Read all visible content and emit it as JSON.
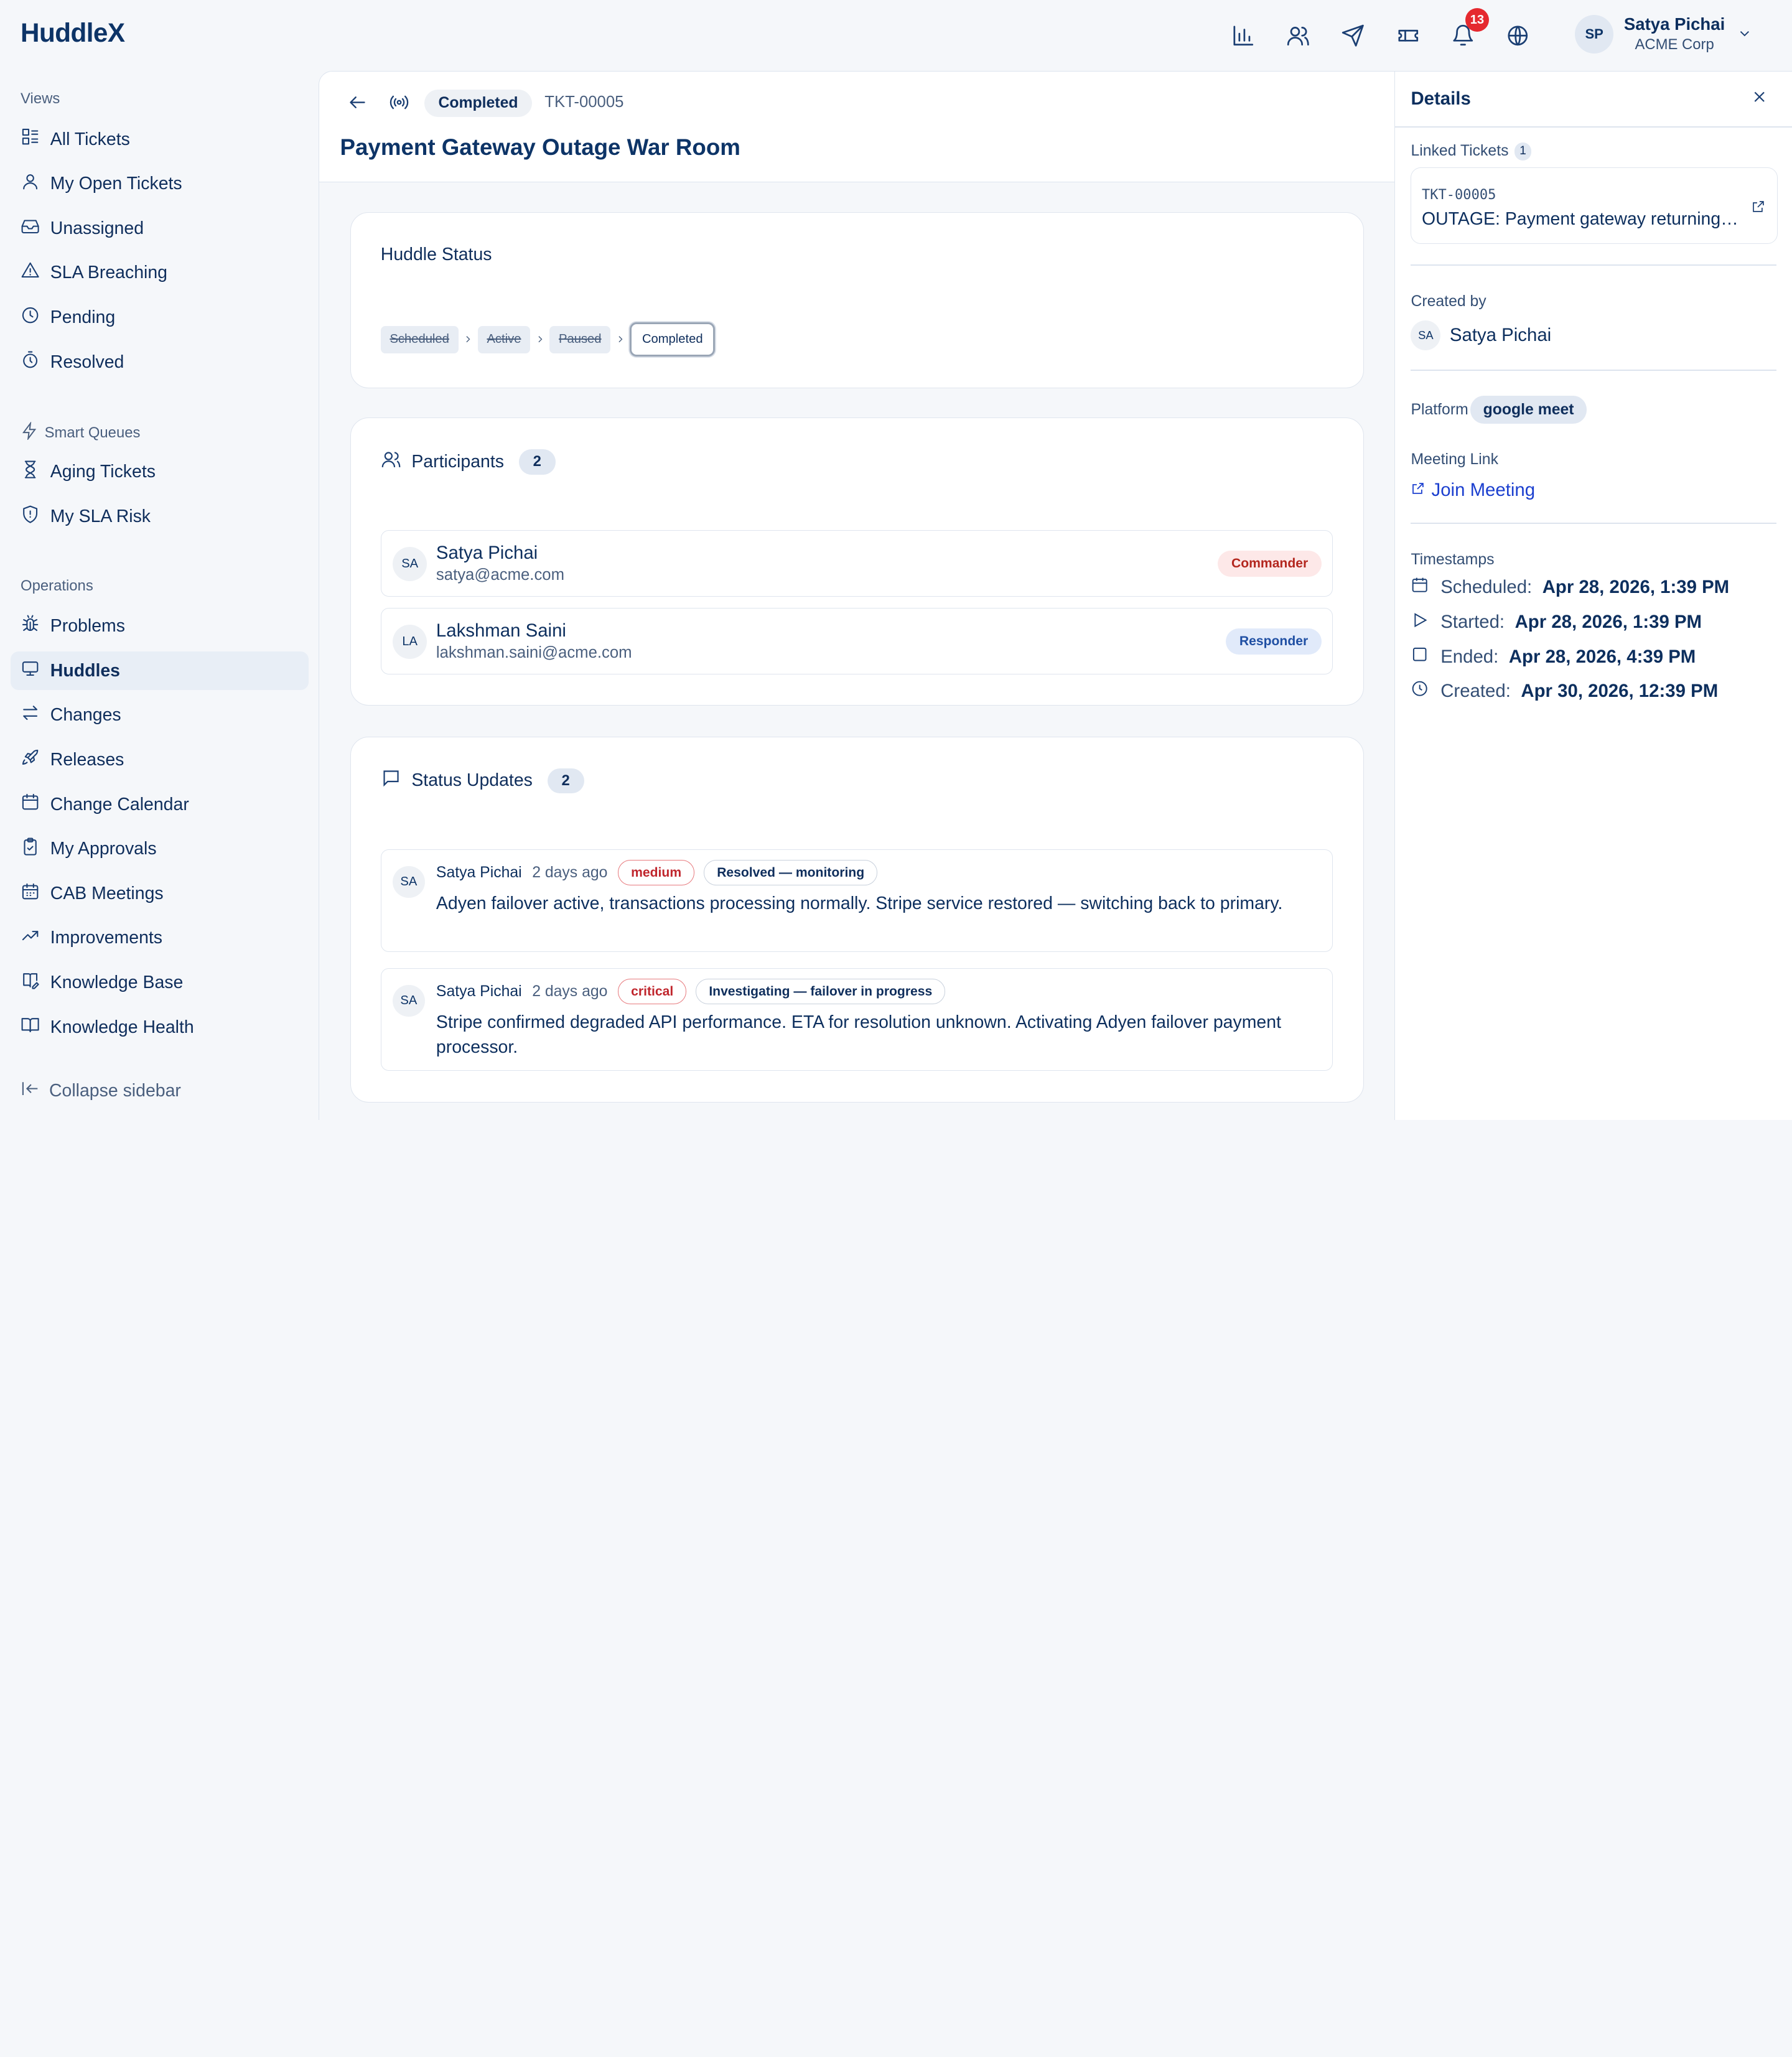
{
  "app": {
    "brand": "HuddleX"
  },
  "header": {
    "notification_count": "13",
    "user": {
      "initials": "SP",
      "name": "Satya Pichai",
      "org": "ACME Corp"
    }
  },
  "sidebar": {
    "views_label": "Views",
    "views": [
      {
        "label": "All Tickets",
        "icon": "list-icon"
      },
      {
        "label": "My Open Tickets",
        "icon": "user-icon"
      },
      {
        "label": "Unassigned",
        "icon": "inbox-icon"
      },
      {
        "label": "SLA Breaching",
        "icon": "warning-icon"
      },
      {
        "label": "Pending",
        "icon": "clock-icon"
      },
      {
        "label": "Resolved",
        "icon": "timer-icon"
      }
    ],
    "smart_label": "Smart Queues",
    "smart": [
      {
        "label": "Aging Tickets",
        "icon": "hourglass-icon"
      },
      {
        "label": "My SLA Risk",
        "icon": "shield-icon"
      }
    ],
    "ops_label": "Operations",
    "ops": [
      {
        "label": "Problems",
        "icon": "bug-icon"
      },
      {
        "label": "Huddles",
        "icon": "monitor-icon",
        "active": true
      },
      {
        "label": "Changes",
        "icon": "swap-icon"
      },
      {
        "label": "Releases",
        "icon": "rocket-icon"
      },
      {
        "label": "Change Calendar",
        "icon": "calendar-icon"
      },
      {
        "label": "My Approvals",
        "icon": "clipboard-check-icon"
      },
      {
        "label": "CAB Meetings",
        "icon": "calendar-grid-icon"
      },
      {
        "label": "Improvements",
        "icon": "trending-up-icon"
      },
      {
        "label": "Knowledge Base",
        "icon": "book-edit-icon"
      },
      {
        "label": "Knowledge Health",
        "icon": "book-open-icon"
      }
    ],
    "collapse_label": "Collapse sidebar"
  },
  "main": {
    "state": "Completed",
    "ticket_id": "TKT-00005",
    "title": "Payment Gateway Outage War Room",
    "huddle_status": {
      "title": "Huddle Status",
      "steps": [
        "Scheduled",
        "Active",
        "Paused",
        "Completed"
      ],
      "current": "Completed"
    },
    "participants": {
      "title": "Participants",
      "count": "2",
      "items": [
        {
          "initials": "SA",
          "name": "Satya Pichai",
          "email": "satya@acme.com",
          "role": "Commander"
        },
        {
          "initials": "LA",
          "name": "Lakshman Saini",
          "email": "lakshman.saini@acme.com",
          "role": "Responder"
        }
      ]
    },
    "status_updates": {
      "title": "Status Updates",
      "count": "2",
      "items": [
        {
          "initials": "SA",
          "author": "Satya Pichai",
          "time": "2 days ago",
          "severity": "medium",
          "status": "Resolved — monitoring",
          "text": "Adyen failover active, transactions processing normally. Stripe service restored — switching back to primary."
        },
        {
          "initials": "SA",
          "author": "Satya Pichai",
          "time": "2 days ago",
          "severity": "critical",
          "status": "Investigating — failover in progress",
          "text": "Stripe confirmed degraded API performance. ETA for resolution unknown. Activating Adyen failover payment processor."
        }
      ]
    }
  },
  "details": {
    "title": "Details",
    "linked_label": "Linked Tickets",
    "linked_count": "1",
    "linked": {
      "id": "TKT-00005",
      "title": "OUTAGE: Payment gateway returning errors"
    },
    "created_by_label": "Created by",
    "creator": {
      "initials": "SA",
      "name": "Satya Pichai"
    },
    "platform_label": "Platform",
    "platform": "google meet",
    "meeting_label": "Meeting Link",
    "join_label": "Join Meeting",
    "timestamps_label": "Timestamps",
    "timestamps": [
      {
        "key": "Scheduled:",
        "value": "Apr 28, 2026, 1:39 PM",
        "icon": "calendar-icon"
      },
      {
        "key": "Started:",
        "value": "Apr 28, 2026, 1:39 PM",
        "icon": "play-icon"
      },
      {
        "key": "Ended:",
        "value": "Apr 28, 2026, 4:39 PM",
        "icon": "stop-icon"
      },
      {
        "key": "Created:",
        "value": "Apr 30, 2026, 12:39 PM",
        "icon": "clock-icon"
      }
    ]
  },
  "colors": {
    "brand": "#0d3467",
    "accent_link": "#1b3fcf",
    "badge_red": "#e5292f",
    "commander": "#b3261e",
    "responder": "#1f4fa3"
  }
}
